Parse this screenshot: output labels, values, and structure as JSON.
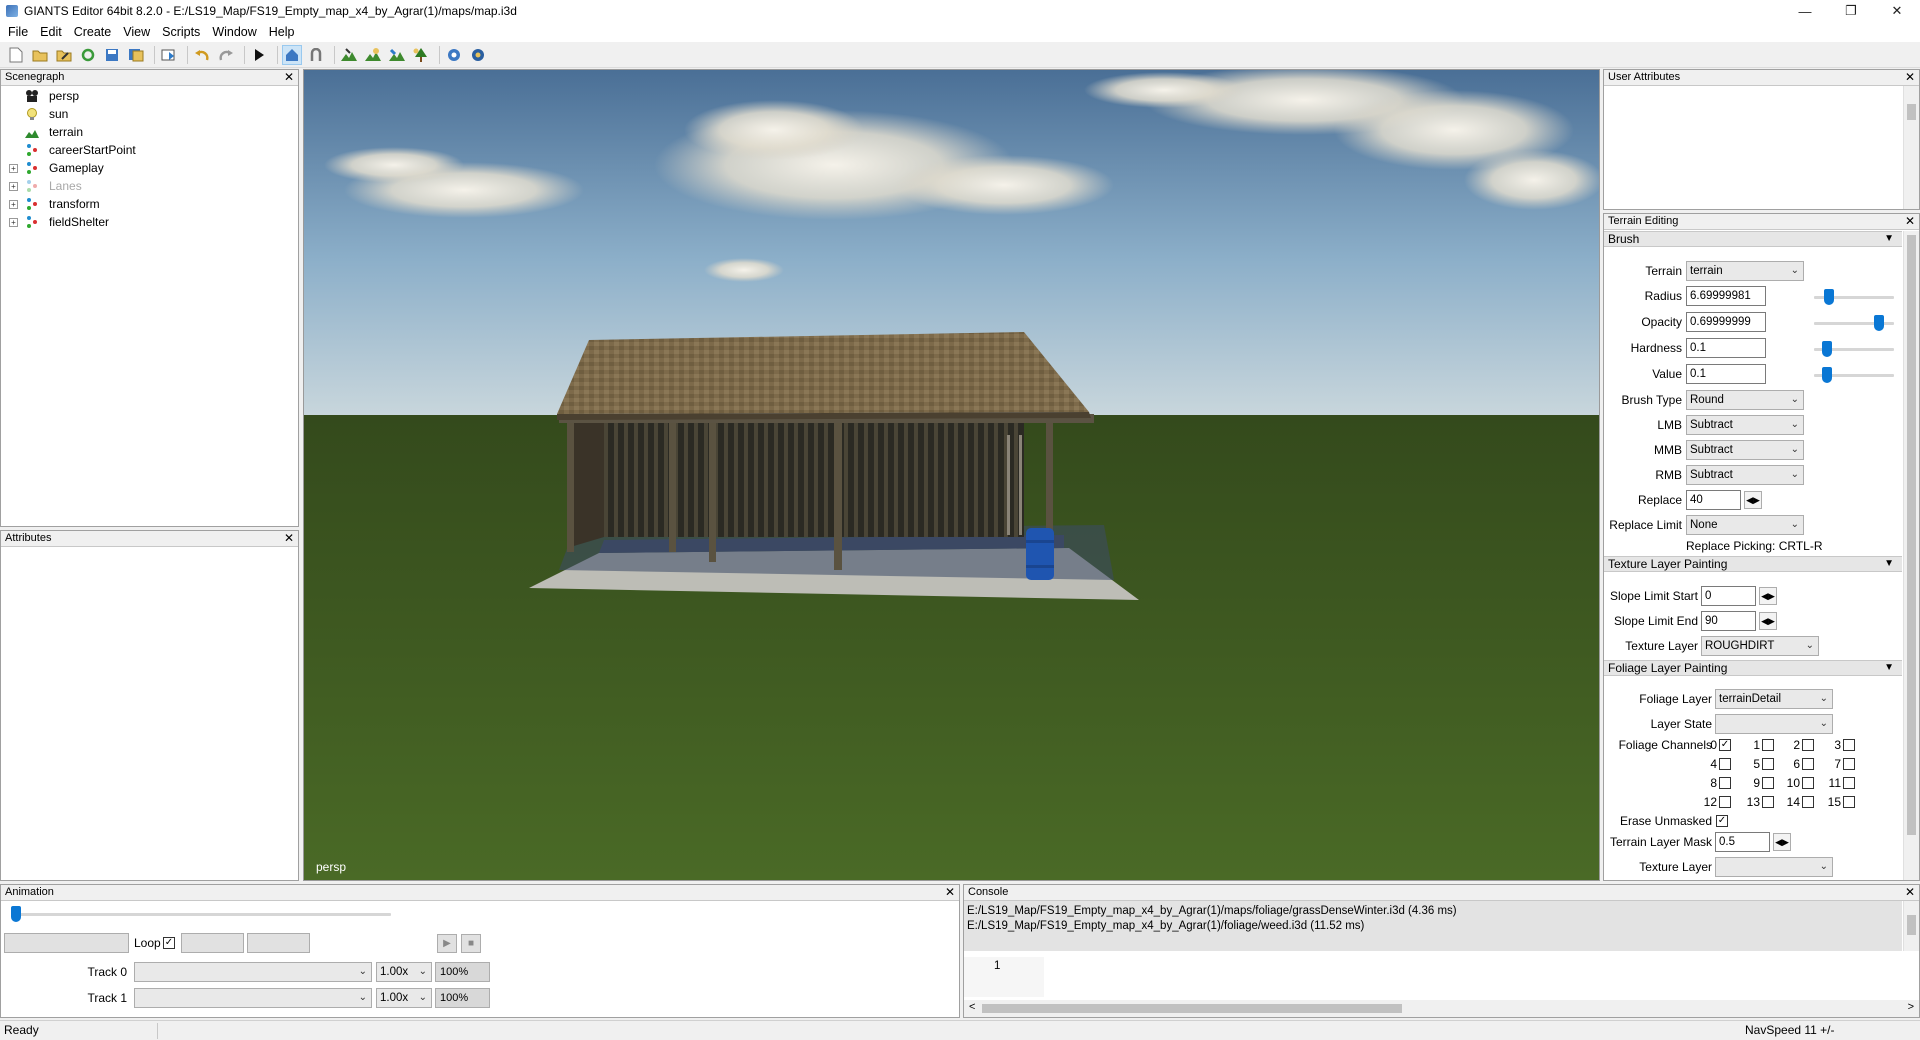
{
  "window": {
    "title": "GIANTS Editor 64bit 8.2.0 - E:/LS19_Map/FS19_Empty_map_x4_by_Agrar(1)/maps/map.i3d",
    "controls": [
      "minimize-icon",
      "maximize-icon",
      "close-icon"
    ]
  },
  "menu": [
    "File",
    "Edit",
    "Create",
    "View",
    "Scripts",
    "Window",
    "Help"
  ],
  "toolbar": {
    "icons": [
      "new-file-icon",
      "open-file-icon",
      "edit-file-icon",
      "refresh-icon",
      "save-icon",
      "save-all-icon",
      "import-icon",
      "undo-icon",
      "redo-icon",
      "play-icon",
      "select-icon",
      "move-icon",
      "terrain-paint-icon",
      "terrain-sculpt-icon",
      "foliage-paint-icon",
      "tree-paint-icon",
      "settings-icon",
      "settings-advanced-icon"
    ]
  },
  "scenegraph": {
    "title": "Scenegraph",
    "items": [
      {
        "label": "persp",
        "icon": "camera-icon",
        "expandable": false,
        "disabled": false
      },
      {
        "label": "sun",
        "icon": "light-bulb-icon",
        "expandable": false,
        "disabled": false
      },
      {
        "label": "terrain",
        "icon": "terrain-icon",
        "expandable": false,
        "disabled": false
      },
      {
        "label": "careerStartPoint",
        "icon": "transform-group-icon",
        "expandable": false,
        "disabled": false
      },
      {
        "label": "Gameplay",
        "icon": "transform-group-icon",
        "expandable": true,
        "disabled": false
      },
      {
        "label": "Lanes",
        "icon": "transform-group-icon",
        "expandable": true,
        "disabled": true
      },
      {
        "label": "transform",
        "icon": "transform-group-icon",
        "expandable": true,
        "disabled": false
      },
      {
        "label": "fieldShelter",
        "icon": "transform-group-icon",
        "expandable": true,
        "disabled": false
      }
    ]
  },
  "attributes": {
    "title": "Attributes"
  },
  "viewport": {
    "camera_label": "persp"
  },
  "user_attributes": {
    "title": "User Attributes"
  },
  "terrain_editing": {
    "title": "Terrain Editing",
    "brush_section": "Brush",
    "terrain": {
      "label": "Terrain",
      "value": "terrain"
    },
    "radius": {
      "label": "Radius",
      "value": "6.69999981",
      "level": 0.13
    },
    "opacity": {
      "label": "Opacity",
      "value": "0.69999999",
      "level": 1.0
    },
    "hardness": {
      "label": "Hardness",
      "value": "0.1",
      "level": 0.1
    },
    "value": {
      "label": "Value",
      "value": "0.1",
      "level": 0.1
    },
    "brush_type": {
      "label": "Brush Type",
      "value": "Round"
    },
    "lmb": {
      "label": "LMB",
      "value": "Subtract"
    },
    "mmb": {
      "label": "MMB",
      "value": "Subtract"
    },
    "rmb": {
      "label": "RMB",
      "value": "Subtract"
    },
    "replace": {
      "label": "Replace",
      "value": "40"
    },
    "replace_limit": {
      "label": "Replace Limit",
      "value": "None"
    },
    "replace_picking": "Replace Picking: CRTL-R",
    "texture_section": "Texture Layer Painting",
    "slope_start": {
      "label": "Slope Limit Start",
      "value": "0"
    },
    "slope_end": {
      "label": "Slope Limit End",
      "value": "90"
    },
    "texture_layer": {
      "label": "Texture Layer",
      "value": "ROUGHDIRT"
    },
    "foliage_section": "Foliage Layer Painting",
    "foliage_layer": {
      "label": "Foliage Layer",
      "value": "terrainDetail"
    },
    "layer_state": {
      "label": "Layer State",
      "value": ""
    },
    "foliage_channels": {
      "label": "Foliage Channels",
      "channels": [
        {
          "n": "0",
          "checked": true
        },
        {
          "n": "1",
          "checked": false
        },
        {
          "n": "2",
          "checked": false
        },
        {
          "n": "3",
          "checked": false
        },
        {
          "n": "4",
          "checked": false
        },
        {
          "n": "5",
          "checked": false
        },
        {
          "n": "6",
          "checked": false
        },
        {
          "n": "7",
          "checked": false
        },
        {
          "n": "8",
          "checked": false
        },
        {
          "n": "9",
          "checked": false
        },
        {
          "n": "10",
          "checked": false
        },
        {
          "n": "11",
          "checked": false
        },
        {
          "n": "12",
          "checked": false
        },
        {
          "n": "13",
          "checked": false
        },
        {
          "n": "14",
          "checked": false
        },
        {
          "n": "15",
          "checked": false
        }
      ]
    },
    "erase_unmasked": {
      "label": "Erase Unmasked",
      "checked": true
    },
    "terrain_layer_mask": {
      "label": "Terrain Layer Mask",
      "value": "0.5"
    },
    "texture_layer2": {
      "label": "Texture Layer",
      "value": ""
    }
  },
  "animation": {
    "title": "Animation",
    "loop_label": "Loop",
    "loop_checked": true,
    "track0": {
      "label": "Track 0",
      "speed": "1.00x",
      "percent": "100%"
    },
    "track1": {
      "label": "Track 1",
      "speed": "1.00x",
      "percent": "100%"
    }
  },
  "console": {
    "title": "Console",
    "lines": [
      "E:/LS19_Map/FS19_Empty_map_x4_by_Agrar(1)/maps/foliage/grassDenseWinter.i3d (4.36 ms)",
      "E:/LS19_Map/FS19_Empty_map_x4_by_Agrar(1)/foliage/weed.i3d (11.52 ms)"
    ],
    "input_line_number": "1"
  },
  "status": {
    "left": "Ready",
    "right": "NavSpeed 11 +/-"
  }
}
